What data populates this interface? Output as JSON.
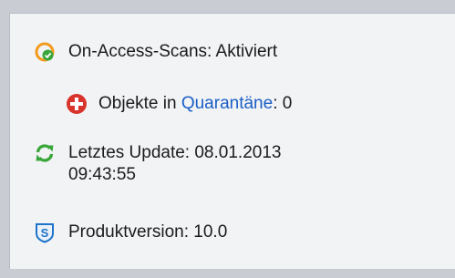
{
  "status": {
    "on_access": {
      "label": "On-Access-Scans: Aktiviert",
      "icon": "scan-status-icon"
    },
    "quarantine": {
      "prefix": "Objekte in ",
      "link": "Quarantäne",
      "suffix": ": 0",
      "icon": "plus-circle-icon"
    },
    "update": {
      "line1": "Letztes Update: 08.01.2013",
      "line2": "09:43:55",
      "icon": "refresh-icon"
    },
    "version": {
      "label": "Produktversion: 10.0",
      "icon": "shield-s-icon"
    }
  },
  "colors": {
    "accent_orange": "#f39a1b",
    "accent_green": "#3aa63a",
    "alert_red": "#d9342b",
    "link_blue": "#1a5fc6",
    "shield_blue": "#1f73c9"
  }
}
